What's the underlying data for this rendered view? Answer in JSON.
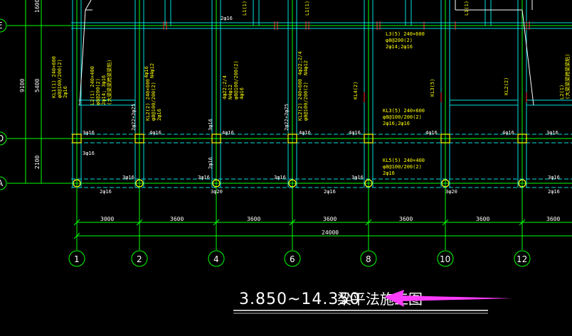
{
  "title": {
    "elevation": "3.850~14.350",
    "name": "梁平法施工图"
  },
  "axes_h": [
    "E",
    "D",
    "A"
  ],
  "axes_v": [
    "1",
    "2",
    "4",
    "6",
    "8",
    "10",
    "12"
  ],
  "dims_bottom": [
    "3000",
    "3600",
    "3600",
    "3600",
    "3600",
    "3600",
    "3600"
  ],
  "dim_total": "24000",
  "dims_left": [
    "9100",
    "5400",
    "1600",
    "2100"
  ],
  "beam_labels": {
    "l1_top": "L1(1)",
    "l1_top2": "L1(1)",
    "l1_top3": "L1(1)",
    "l2a": "2φ16",
    "l3": "L3(5) 240×600",
    "l3b": "φ8@200(2)",
    "l3c": "2φ14;2φ16",
    "l2_left": "L2(1) 240×400",
    "l2_left_b": "φ8@200(2)",
    "l2_left_c": "2φ14; 3φ16",
    "l2_left_d": "(大梁梁梁跨梁梁粘)",
    "kl1": "KL1(1) 240×600",
    "kl1b": "φ8@100/200(2)",
    "kl1c": "2φ16",
    "kl2": "KL2(2) 240×600",
    "kl2b": "φ8@100/200(2)",
    "kl2c": "2φ16",
    "kl3": "KL3(5) 240×600",
    "kl3b": "φ8@100/200(2)",
    "kl3c": "2φ16;2φ16",
    "kl5": "KL5(5) 240×400",
    "kl5b": "φ8@100/200(2)",
    "kl5c": "2φ16",
    "kl4": "KL4(2)",
    "kl4b": "KL2(2)",
    "kl2_right": "L2(1)",
    "kl2_right_b": "(大梁梁梁跨梁梁粘)",
    "kl6": "KL3(5)",
    "kl7": "4φ16",
    "kl8": "4φ22;2/4",
    "kl8b": "N4φ12",
    "kl9": "4φ22;2/4",
    "kl9b": "N4φ12",
    "kl10": "φ8@100/200(2)",
    "kl11": "KL2(2) 240×600",
    "kl12": "φ8@100/200(2)",
    "kl13": "4φ16"
  },
  "rebar_labels": {
    "r1": "3φ16",
    "r2": "4φ16",
    "r3": "4φ16",
    "r4": "4φ16",
    "r5": "4φ16",
    "r6": "4φ16",
    "r7": "4φ16",
    "r8": "3φ16",
    "r9": "3φ16",
    "r10": "3φ16",
    "r11": "3φ16",
    "r12": "3φ16",
    "r13": "2φ16",
    "r14": "3φ20",
    "r15": "2φ16",
    "r16": "3φ20",
    "r17": "2φ16",
    "r18": "2φ22+2φ25",
    "r19": "2φ22+2φ25",
    "r20": "2φ16",
    "r21": "3φ16",
    "r22": "3φ16",
    "r23": "2φ16",
    "r24": "3φ16"
  },
  "colors": {
    "grid": "#00ff00",
    "beam_main": "#00ffff",
    "column": "#ffff00",
    "text_yellow": "#ffff00",
    "arrow": "#ff00ff",
    "dim": "#ffffff",
    "beam_red": "#ff0000"
  }
}
